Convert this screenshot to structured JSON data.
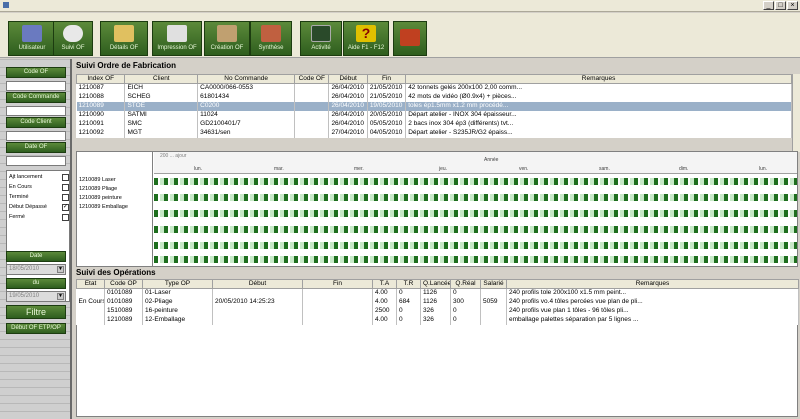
{
  "window": {
    "title": "",
    "min": "_",
    "max": "□",
    "close": "×"
  },
  "toolbar": {
    "buttons": [
      {
        "label": "Utilisateur",
        "icon": "users-icon",
        "color": "#6a7ac0"
      },
      {
        "label": "Suivi OF",
        "icon": "clock-icon",
        "color": "#e0e0e0"
      },
      {
        "label": "Détails OF",
        "icon": "bell-icon",
        "color": "#e0c060"
      },
      {
        "label": "Impression OF",
        "icon": "printer-icon",
        "color": "#e0e0e0"
      },
      {
        "label": "Création OF",
        "icon": "folder-icon",
        "color": "#c0a070"
      },
      {
        "label": "Synthèse",
        "icon": "chart-icon",
        "color": "#c06040"
      },
      {
        "label": "Activité",
        "icon": "monitor-icon",
        "color": "#2a4a2a"
      },
      {
        "label": "Aide F1 - F12",
        "icon": "help-icon",
        "color": "#e0c000"
      },
      {
        "label": "",
        "icon": "exit-icon",
        "color": "#c04020"
      }
    ]
  },
  "sidebar": {
    "code_of_label": "Code OF",
    "code_commande_label": "Code Commande",
    "code_client_label": "Code Client",
    "date_of_label": "Date OF",
    "checks": [
      {
        "label": "Ajt lancement",
        "checked": ""
      },
      {
        "label": "En Cours",
        "checked": ""
      },
      {
        "label": "Terminé",
        "checked": ""
      },
      {
        "label": "Début Dépassé",
        "checked": "✓"
      },
      {
        "label": "Fermé",
        "checked": ""
      }
    ],
    "date_label": "Date",
    "date_value": "18/05/2010",
    "du_label": "du",
    "du_value": "19/05/2010",
    "filtre_label": "Filtre",
    "debut_label": "Début OF ETP/OP"
  },
  "suivi_of": {
    "title": "Suivi Ordre de Fabrication",
    "columns": [
      "Index OF",
      "Client",
      "No Commande",
      "Code OF",
      "Début",
      "Fin",
      "Remarques"
    ],
    "rows": [
      [
        "1210087",
        "EICH",
        "CA0000/066-0553",
        "",
        "26/04/2010",
        "21/05/2010",
        "42 tonnets gelés 200x100 2,00 comm..."
      ],
      [
        "1210088",
        "SCHEG",
        "61801434",
        "",
        "26/04/2010",
        "21/05/2010",
        "42 mots de vidéo (Ø0.9x4) + pièces..."
      ],
      [
        "1210089",
        "STOE",
        "C0200",
        "",
        "26/04/2010",
        "19/05/2010",
        "toles ép1.5mm x1.2 mm procédé..."
      ],
      [
        "1210090",
        "SATMI",
        "11024",
        "",
        "26/04/2010",
        "20/05/2010",
        "Départ atelier - INOX 304 épaisseur..."
      ],
      [
        "1210091",
        "SMC",
        "GD2100401/7",
        "",
        "26/04/2010",
        "05/05/2010",
        "2 bacs inox 304 ép3 (différents) tvt..."
      ],
      [
        "1210092",
        "MGT",
        "34631/sen",
        "",
        "27/04/2010",
        "04/05/2010",
        "Départ atelier - S235JR/G2 épaiss..."
      ]
    ],
    "selected_row": 2
  },
  "gantt": {
    "header_label": "200 ... ajour",
    "month_label": "Année",
    "months": [
      "lun.",
      "mar.",
      "mer.",
      "jeu.",
      "ven.",
      "sam.",
      "dim.",
      "lun."
    ],
    "rows": [
      "1210089 Laser",
      "1210089 Pliage",
      "1210089 peinture",
      "1210089 Emballage"
    ]
  },
  "suivi_ops": {
    "title": "Suivi des Opérations",
    "columns": [
      "Etat",
      "Code OP",
      "Type OP",
      "Début",
      "Fin",
      "T.A",
      "T.R",
      "Q.Lancée",
      "Q.Réal",
      "Salarié",
      "Remarques"
    ],
    "rows": [
      [
        "",
        "0101089",
        "01-Laser",
        "",
        "",
        "4.00",
        "0",
        "1126",
        "0",
        "",
        "240 profils tole 200x100 x1.5 mm peint..."
      ],
      [
        "En Cours",
        "0101089",
        "02-Pliage",
        "20/05/2010 14:25:23",
        "",
        "4.00",
        "684",
        "1126",
        "300",
        "5059",
        "240 profils vo.4 tôles percées vue plan de pli..."
      ],
      [
        "",
        "1510089",
        "16-peinture",
        "",
        "",
        "2500",
        "0",
        "326",
        "0",
        "",
        "240 profils vue plan 1 tôles - 96 tôles pli..."
      ],
      [
        "",
        "1210089",
        "12-Emballage",
        "",
        "",
        "4.00",
        "0",
        "326",
        "0",
        "",
        "emballage palettes séparation par 5 lignes ..."
      ]
    ]
  }
}
